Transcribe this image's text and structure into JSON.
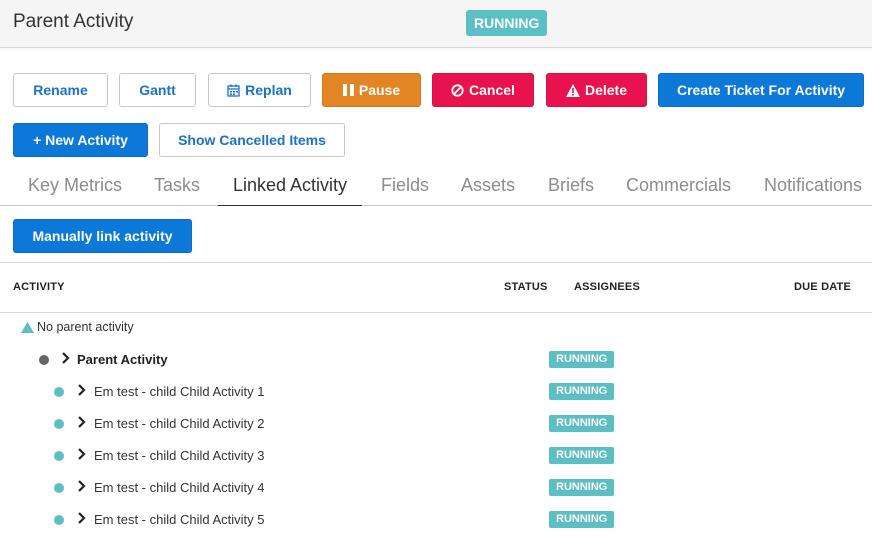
{
  "header": {
    "title": "Parent Activity",
    "status": "RUNNING"
  },
  "toolbar": {
    "rename": "Rename",
    "gantt": "Gantt",
    "replan": "Replan",
    "pause": "Pause",
    "cancel": "Cancel",
    "delete": "Delete",
    "create_ticket": "Create Ticket For Activity",
    "new_activity": "+ New Activity",
    "show_cancelled": "Show Cancelled Items"
  },
  "tabs": [
    {
      "label": "Key Metrics",
      "active": false
    },
    {
      "label": "Tasks",
      "active": false
    },
    {
      "label": "Linked Activity",
      "active": true
    },
    {
      "label": "Fields",
      "active": false
    },
    {
      "label": "Assets",
      "active": false
    },
    {
      "label": "Briefs",
      "active": false
    },
    {
      "label": "Commercials",
      "active": false
    },
    {
      "label": "Notifications",
      "active": false
    }
  ],
  "manual_link_label": "Manually link activity",
  "table": {
    "headers": {
      "activity": "ACTIVITY",
      "status": "STATUS",
      "assignees": "ASSIGNEES",
      "due_date": "DUE DATE"
    },
    "root_label": "No parent activity",
    "parent": {
      "name": "Parent Activity",
      "status": "RUNNING"
    },
    "children": [
      {
        "name": "Em test - child Child Activity 1",
        "status": "RUNNING"
      },
      {
        "name": "Em test - child Child Activity 2",
        "status": "RUNNING"
      },
      {
        "name": "Em test - child Child Activity 3",
        "status": "RUNNING"
      },
      {
        "name": "Em test - child Child Activity 4",
        "status": "RUNNING"
      },
      {
        "name": "Em test - child Child Activity 5",
        "status": "RUNNING"
      }
    ]
  },
  "colors": {
    "running": "#5bc0c4",
    "primary": "#0c79d9",
    "pause": "#e38524",
    "danger": "#e8124f",
    "parent_dot": "#666666"
  },
  "icons": {
    "replan": "calendar-icon",
    "pause": "pause-icon",
    "cancel": "ban-icon",
    "delete": "warning-icon",
    "root": "triangle-icon",
    "expand": "chevron-right-icon"
  }
}
